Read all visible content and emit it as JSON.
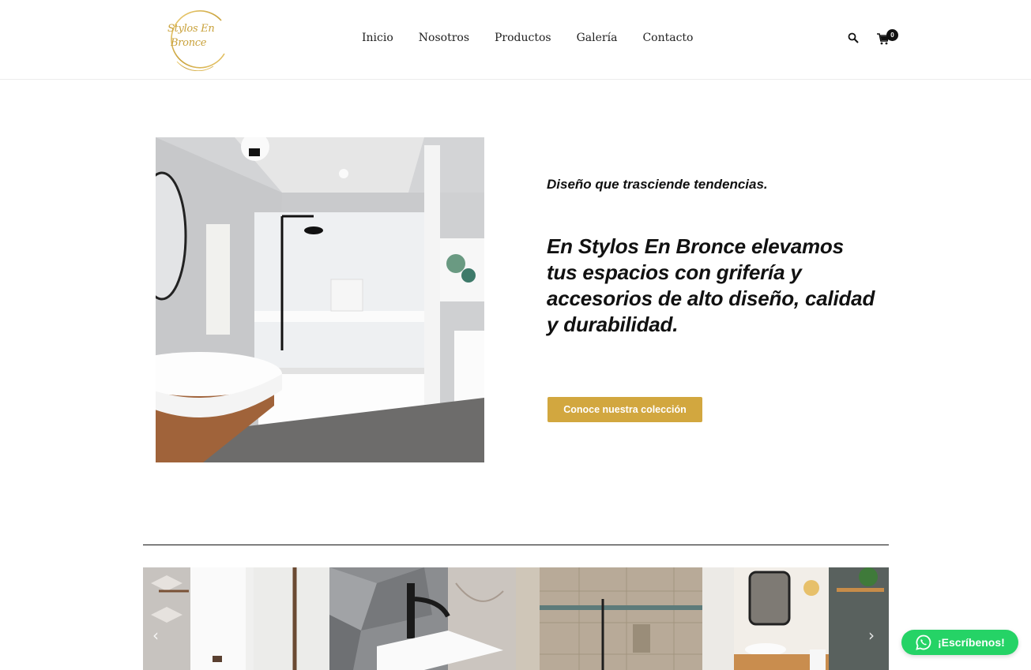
{
  "brand": {
    "logo_line1": "Stylos En",
    "logo_line2": "Bronce",
    "color": "#c9a23c"
  },
  "nav": {
    "items": [
      {
        "label": "Inicio"
      },
      {
        "label": "Nosotros"
      },
      {
        "label": "Productos"
      },
      {
        "label": "Galería"
      },
      {
        "label": "Contacto"
      }
    ]
  },
  "header_icons": {
    "search": "search-icon",
    "cart": "cart-icon",
    "cart_count": "0"
  },
  "hero": {
    "subtitle": "Diseño que trasciende tendencias.",
    "title": "En Stylos En Bronce elevamos tus espacios con grifería y accesorios de alto diseño, calidad y durabilidad.",
    "cta_label": "Conoce nuestra colección",
    "accent": "#d2a73f"
  },
  "gallery": {
    "prev_icon": "‹",
    "next_icon": "›"
  },
  "whatsapp": {
    "label": "¡Escríbenos!",
    "color": "#25d366"
  }
}
